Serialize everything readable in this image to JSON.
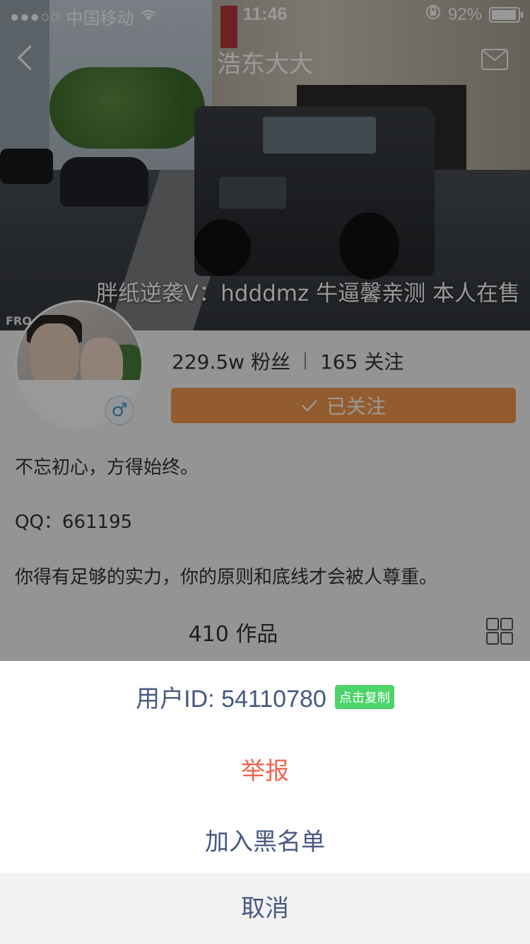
{
  "status_bar": {
    "signal": "●●●○○",
    "carrier": "中国移动",
    "time": "11:46",
    "battery": "92%",
    "battery_level": 0.92
  },
  "nav": {
    "title": "浩东大大",
    "back_icon": "chevron-left-icon",
    "message_icon": "mail-icon"
  },
  "banner": {
    "overlay_text": "胖纸逆袭V：hdddmz 牛逼馨亲测 本人在售",
    "corner_tag": "FRO"
  },
  "profile": {
    "followers": "229.5w 粉丝",
    "following": "165 关注",
    "follow_button": "已关注",
    "gender_symbol": "♂",
    "bio_lines": [
      "不忘初心，方得始终。",
      "QQ：661195",
      "你得有足够的实力，你的原则和底线才会被人尊重。"
    ],
    "works": "410 作品"
  },
  "action_sheet": {
    "user_id": "用户ID: 54110780",
    "copy_label": "点击复制",
    "report": "举报",
    "blacklist": "加入黑名单",
    "cancel": "取消"
  },
  "colors": {
    "follow_button": "#f59a4e",
    "report_text": "#f2644e",
    "sheet_text": "#475982",
    "copy_badge": "#4cd36a",
    "dim_overlay": "rgba(0,0,0,0.40)"
  }
}
